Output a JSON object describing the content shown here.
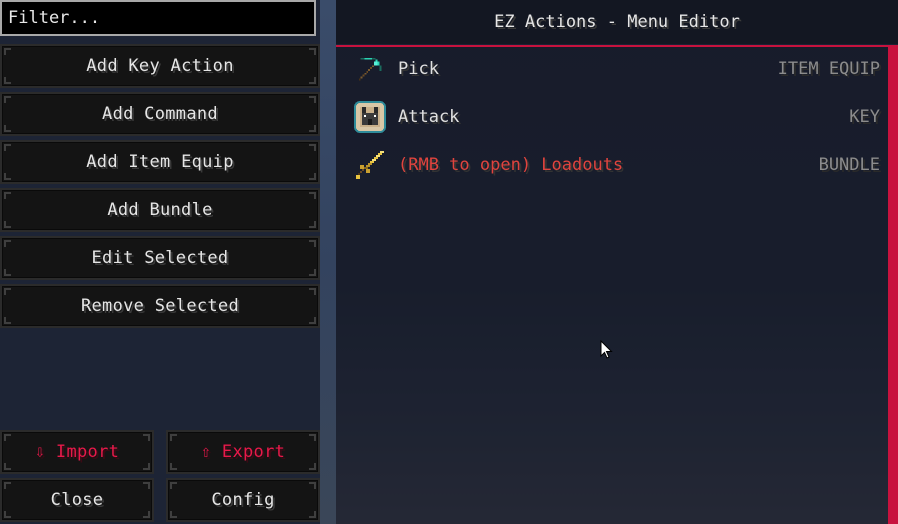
{
  "filter": {
    "placeholder": "Filter...",
    "value": ""
  },
  "sidebar": {
    "buttons": [
      {
        "label": "Add Key Action"
      },
      {
        "label": "Add Command"
      },
      {
        "label": "Add Item Equip"
      },
      {
        "label": "Add Bundle"
      },
      {
        "label": "Edit Selected"
      },
      {
        "label": "Remove Selected"
      }
    ],
    "import_label": "⇩ Import",
    "export_label": "⇧ Export",
    "close_label": "Close",
    "config_label": "Config",
    "accent_color": "#e8194a"
  },
  "editor": {
    "title": "EZ Actions - Menu Editor",
    "accent_color": "#c8123e",
    "items": [
      {
        "name": "Pick",
        "type": "ITEM EQUIP",
        "icon": "diamond-pickaxe-icon",
        "color": "#e0e0e0"
      },
      {
        "name": "Attack",
        "type": "KEY",
        "icon": "wolf-icon",
        "color": "#e0e0e0"
      },
      {
        "name": "(RMB to open) Loadouts",
        "type": "BUNDLE",
        "icon": "golden-sword-icon",
        "color": "#e0443e"
      }
    ]
  }
}
